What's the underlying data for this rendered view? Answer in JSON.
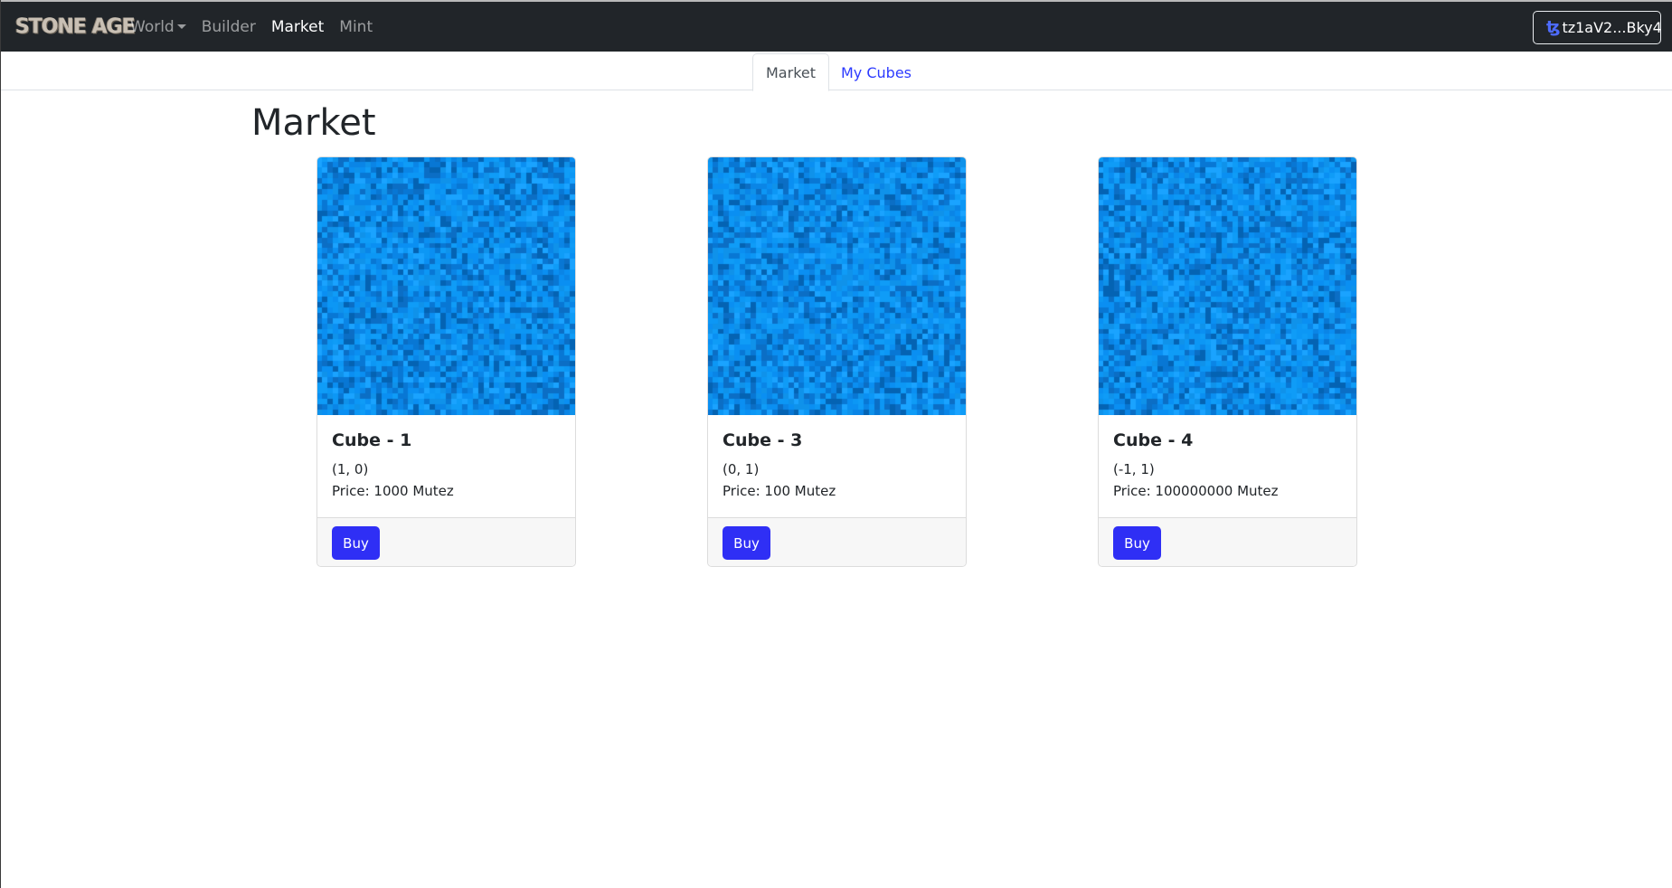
{
  "navbar": {
    "brand": "STONE AGE",
    "links": [
      {
        "label": "World"
      },
      {
        "label": "Builder"
      },
      {
        "label": "Market"
      },
      {
        "label": "Mint"
      }
    ],
    "wallet_label": "tz1aV2...Bky4",
    "wallet_icon": "ꜩ"
  },
  "tabs": [
    {
      "label": "Market"
    },
    {
      "label": "My Cubes"
    }
  ],
  "page_title": "Market",
  "cards": [
    {
      "title": "Cube - 1",
      "coords": "(1, 0)",
      "price": "Price: 1000 Mutez",
      "button": "Buy"
    },
    {
      "title": "Cube - 3",
      "coords": "(0, 1)",
      "price": "Price: 100 Mutez",
      "button": "Buy"
    },
    {
      "title": "Cube - 4",
      "coords": "(-1, 1)",
      "price": "Price: 100000000 Mutez",
      "button": "Buy"
    }
  ],
  "colors": {
    "navbar_bg": "#212529",
    "button_primary": "#2f2ff5",
    "tab_link": "#2d3bff",
    "cube_palette": [
      "#0a8ff2",
      "#0c97f5",
      "#0f9cf7",
      "#0a85e6",
      "#0877d4",
      "#1aa3ff",
      "#0b6ec5",
      "#0463b3",
      "#0f92ea"
    ]
  }
}
